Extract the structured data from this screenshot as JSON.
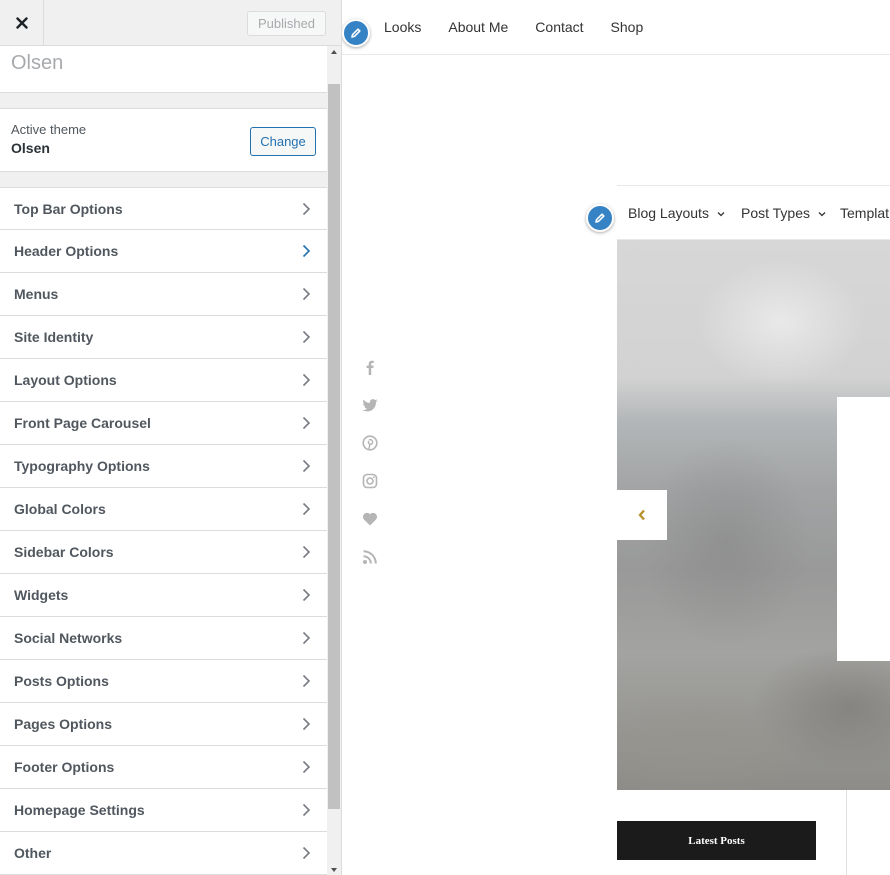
{
  "customizer": {
    "close_icon": "close-icon",
    "publish_label": "Published",
    "site_title": "Olsen",
    "theme": {
      "label": "Active theme",
      "name": "Olsen",
      "change_label": "Change"
    },
    "sections": [
      {
        "label": "Top Bar Options"
      },
      {
        "label": "Header Options",
        "active": true
      },
      {
        "label": "Menus"
      },
      {
        "label": "Site Identity"
      },
      {
        "label": "Layout Options"
      },
      {
        "label": "Front Page Carousel"
      },
      {
        "label": "Typography Options"
      },
      {
        "label": "Global Colors"
      },
      {
        "label": "Sidebar Colors"
      },
      {
        "label": "Widgets"
      },
      {
        "label": "Social Networks"
      },
      {
        "label": "Posts Options"
      },
      {
        "label": "Pages Options"
      },
      {
        "label": "Footer Options"
      },
      {
        "label": "Homepage Settings"
      },
      {
        "label": "Other"
      }
    ],
    "accent_color": "#2271b1"
  },
  "preview": {
    "top_menu": [
      "Looks",
      "About Me",
      "Contact",
      "Shop"
    ],
    "main_nav": [
      {
        "label": "Blog Layouts",
        "dropdown": true
      },
      {
        "label": "Post Types",
        "dropdown": true
      },
      {
        "label": "Templat",
        "dropdown": false
      }
    ],
    "social_icons": [
      "facebook-icon",
      "twitter-icon",
      "pinterest-icon",
      "instagram-icon",
      "heart-icon",
      "rss-icon"
    ],
    "carousel_prev_icon": "chevron-left-icon",
    "latest_posts_label": "Latest Posts",
    "edit_shortcut_color": "#3582c4",
    "carousel_arrow_color": "#b8922e"
  }
}
